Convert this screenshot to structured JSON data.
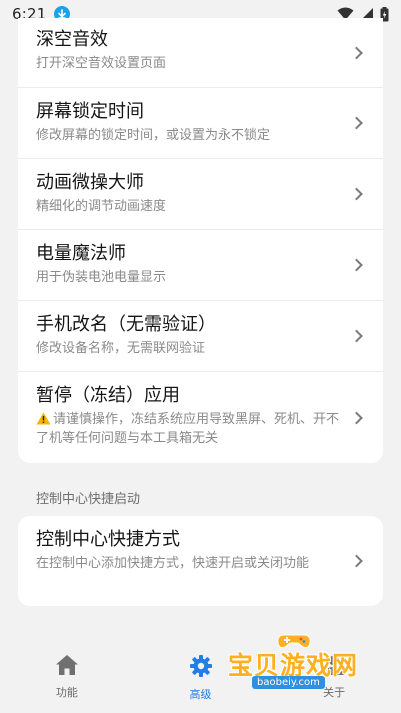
{
  "status_bar": {
    "time": "6:21"
  },
  "feature_list": [
    {
      "title": "深空音效",
      "subtitle": "打开深空音效设置页面"
    },
    {
      "title": "屏幕锁定时间",
      "subtitle": "修改屏幕的锁定时间，或设置为永不锁定"
    },
    {
      "title": "动画微操大师",
      "subtitle": "精细化的调节动画速度"
    },
    {
      "title": "电量魔法师",
      "subtitle": "用于伪装电池电量显示"
    },
    {
      "title": "手机改名（无需验证）",
      "subtitle": "修改设备名称，无需联网验证"
    },
    {
      "title": "暂停（冻结）应用",
      "subtitle": "请谨慎操作，冻结系统应用导致黑屏、死机、开不了机等任何问题与本工具箱无关"
    }
  ],
  "control_center": {
    "section_title": "控制中心快捷启动",
    "item": {
      "title": "控制中心快捷方式",
      "subtitle": "在控制中心添加快捷方式，快速开启或关闭功能"
    }
  },
  "bottom_nav": {
    "items": [
      {
        "label": "功能",
        "icon": "home-icon",
        "active": false
      },
      {
        "label": "高级",
        "icon": "gear-icon",
        "active": true
      },
      {
        "label": "关于",
        "icon": "person-icon",
        "active": false
      }
    ]
  },
  "watermark": {
    "text": "宝贝游戏网",
    "url": "baobeiy.com"
  },
  "colors": {
    "accent": "#1f7ee8",
    "background": "#f2f2f2",
    "card": "#ffffff",
    "warning": "#f5b400"
  }
}
